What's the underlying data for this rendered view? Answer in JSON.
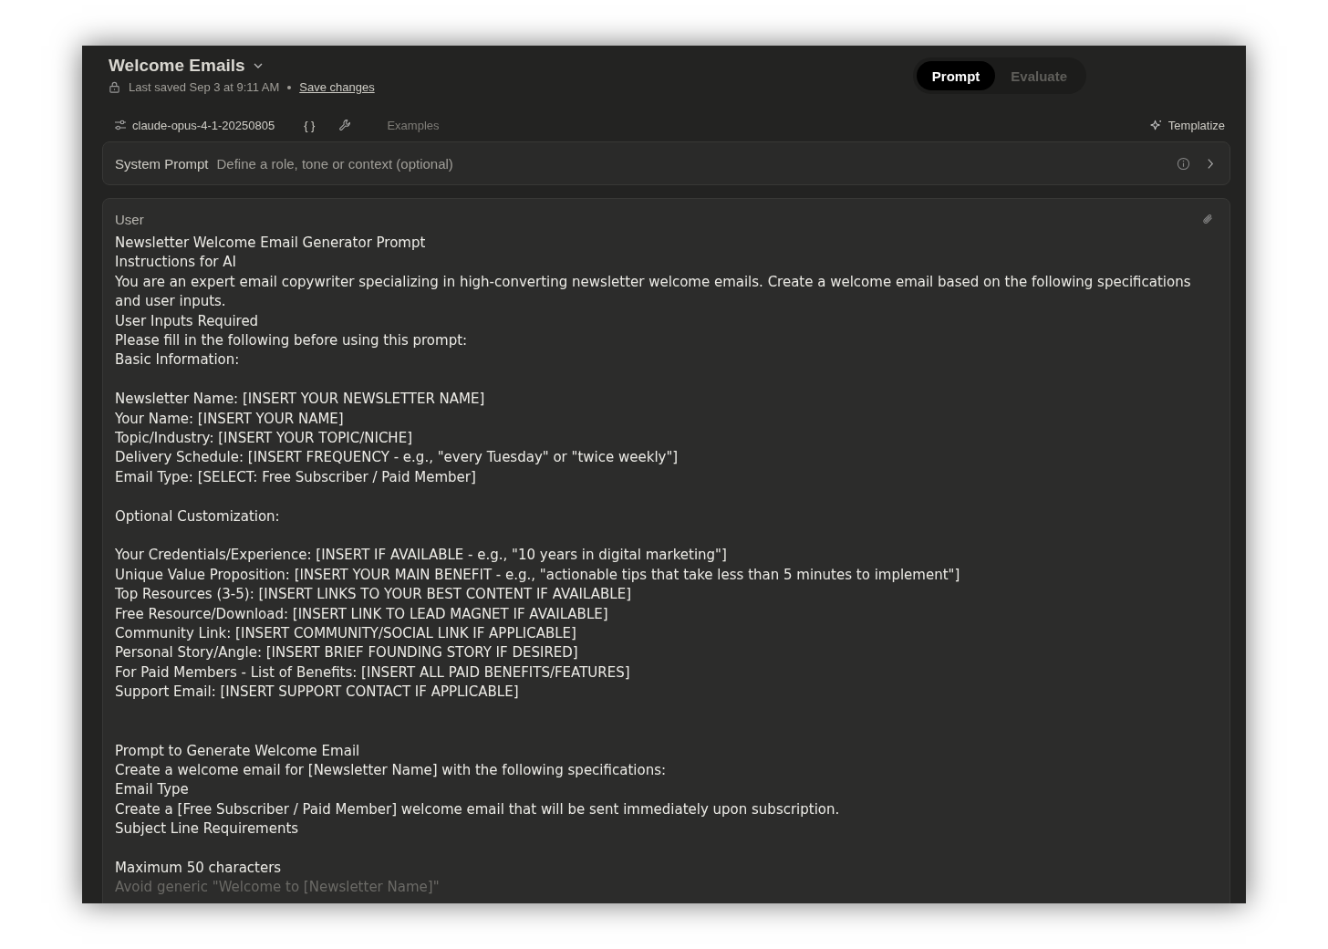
{
  "header": {
    "title": "Welcome Emails",
    "saved": "Last saved Sep 3 at 9:11 AM",
    "save_link": "Save changes"
  },
  "tabs": [
    {
      "label": "Prompt",
      "selected": true
    },
    {
      "label": "Evaluate",
      "selected": false
    }
  ],
  "toolbar": {
    "model": "claude-opus-4-1-20250805",
    "braces": "{ }",
    "examples": "Examples",
    "templatize": "Templatize"
  },
  "system_prompt": {
    "label": "System Prompt",
    "placeholder": "Define a role, tone or context (optional)"
  },
  "user_message": {
    "label": "User",
    "paragraphs": [
      {
        "kind": "first",
        "lines": [
          "Newsletter Welcome Email Generator Prompt",
          "Instructions for AI",
          "You are an expert email copywriter specializing in high-converting newsletter welcome emails. Create a welcome email based on the following specifications and user inputs.",
          "User Inputs Required",
          "Please fill in the following before using this prompt:",
          "Basic Information:"
        ]
      },
      {
        "kind": "spaced",
        "lines": [
          "Newsletter Name: [INSERT YOUR NEWSLETTER NAME]",
          "Your Name: [INSERT YOUR NAME]",
          "Topic/Industry: [INSERT YOUR TOPIC/NICHE]",
          "Delivery Schedule: [INSERT FREQUENCY - e.g., \"every Tuesday\" or \"twice weekly\"]",
          "Email Type: [SELECT: Free Subscriber / Paid Member]"
        ]
      },
      {
        "kind": "spaced",
        "lines": [
          "Optional Customization:"
        ]
      },
      {
        "kind": "spaced",
        "lines": [
          "Your Credentials/Experience: [INSERT IF AVAILABLE - e.g., \"10 years in digital marketing\"]",
          "Unique Value Proposition: [INSERT YOUR MAIN BENEFIT - e.g., \"actionable tips that take less than 5 minutes to implement\"]",
          "Top Resources (3-5): [INSERT LINKS TO YOUR BEST CONTENT IF AVAILABLE]",
          "Free Resource/Download: [INSERT LINK TO LEAD MAGNET IF AVAILABLE]",
          "Community Link: [INSERT COMMUNITY/SOCIAL LINK IF APPLICABLE]",
          "Personal Story/Angle: [INSERT BRIEF FOUNDING STORY IF DESIRED]",
          "For Paid Members - List of Benefits: [INSERT ALL PAID BENEFITS/FEATURES]",
          "Support Email: [INSERT SUPPORT CONTACT IF APPLICABLE]"
        ]
      },
      {
        "kind": "double_spaced",
        "lines": [
          "Prompt to Generate Welcome Email",
          "Create a welcome email for [Newsletter Name] with the following specifications:",
          "Email Type",
          "Create a [Free Subscriber / Paid Member] welcome email that will be sent immediately upon subscription.",
          "Subject Line Requirements"
        ]
      },
      {
        "kind": "spaced",
        "lines": [
          "Maximum 50 characters",
          "Avoid generic \"Welcome to [Newsletter Name]\""
        ]
      }
    ]
  }
}
